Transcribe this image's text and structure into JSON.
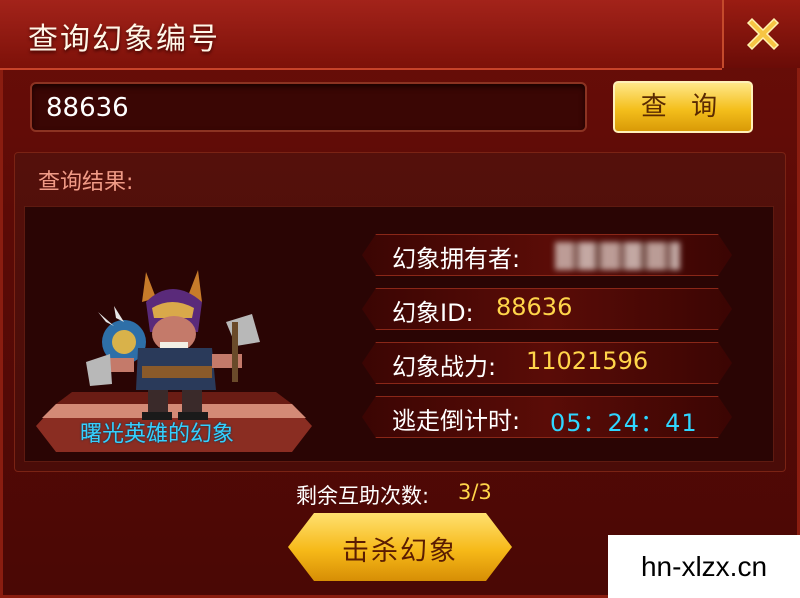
{
  "dialog": {
    "title": "查询幻象编号"
  },
  "search": {
    "value": "88636",
    "button_label": "查 询"
  },
  "result": {
    "label": "查询结果:",
    "hero_name": "曙光英雄的幻象",
    "owner_label": "幻象拥有者:",
    "id_label": "幻象ID:",
    "id_value": "88636",
    "power_label": "幻象战力:",
    "power_value": "11021596",
    "countdown_label": "逃走倒计时:",
    "countdown_value": "05：24：41"
  },
  "remaining": {
    "label": "剩余互助次数:",
    "value": "3/3"
  },
  "kill_button": {
    "label": "击杀幻象"
  },
  "watermark": {
    "text": "hn-xlzx.cn"
  },
  "colors": {
    "accent_gold": "#ffd54a",
    "countdown_cyan": "#2fd6ff",
    "panel_red": "#6b0e08"
  }
}
